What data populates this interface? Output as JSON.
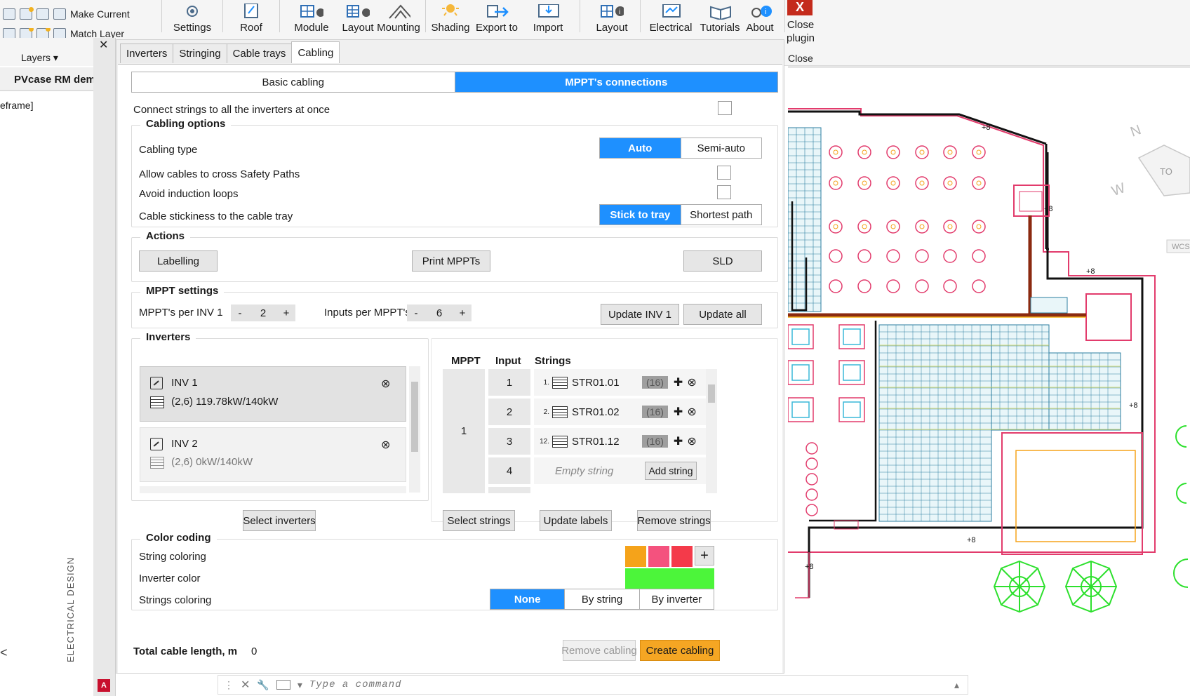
{
  "ribbon": {
    "layers_row1": "Make Current",
    "layers_row2": "Match Layer",
    "layers_panel": "Layers",
    "buttons": [
      {
        "label": "Settings",
        "icon": "gear-icon"
      },
      {
        "label": "Roof",
        "icon": "roof-icon"
      },
      {
        "label": "Module",
        "icon": "module-settings-icon"
      },
      {
        "label": "Layout",
        "icon": "layout-settings-icon"
      },
      {
        "label": "Mounting",
        "icon": "mounting-icon"
      },
      {
        "label": "Shading",
        "icon": "sun-icon"
      },
      {
        "label": "Export to",
        "icon": "export-icon"
      },
      {
        "label": "Import",
        "icon": "import-icon"
      },
      {
        "label": "Layout",
        "icon": "layout-info-icon"
      },
      {
        "label": "Electrical",
        "icon": "electrical-icon"
      },
      {
        "label": "Tutorials",
        "icon": "book-icon"
      },
      {
        "label": "About",
        "icon": "about-icon"
      }
    ],
    "close_plugin_line1": "Close",
    "close_plugin_line2": "plugin",
    "close_panel": "Close",
    "close_glyph": "X"
  },
  "document": {
    "tab_title": "PVcase RM dem",
    "viewport_label": "eframe]",
    "left_arrow": "<"
  },
  "sidebar": {
    "close_glyph": "✕",
    "vertical_title": "ELECTRICAL DESIGN"
  },
  "panel": {
    "tabs": [
      "Inverters",
      "Stringing",
      "Cable trays",
      "Cabling"
    ],
    "mode_tabs": [
      "Basic cabling",
      "MPPT's connections"
    ],
    "connect_all_label": "Connect strings to all the inverters at once",
    "cabling_options": {
      "title": "Cabling options",
      "cabling_type_label": "Cabling type",
      "cabling_type_options": [
        "Auto",
        "Semi-auto"
      ],
      "cross_safety_label": "Allow cables to cross Safety Paths",
      "avoid_loops_label": "Avoid induction loops",
      "stickiness_label": "Cable stickiness to the cable tray",
      "stickiness_options": [
        "Stick to tray",
        "Shortest path"
      ]
    },
    "actions": {
      "title": "Actions",
      "labelling": "Labelling",
      "print_mppts": "Print MPPTs",
      "sld": "SLD"
    },
    "mppt_settings": {
      "title": "MPPT settings",
      "mppt_per_inv_label": "MPPT's per INV 1",
      "mppt_per_inv_value": "2",
      "inputs_per_mppt_label": "Inputs per MPPT's",
      "inputs_per_mppt_value": "6",
      "minus": "-",
      "plus": "+",
      "update_inv": "Update INV 1",
      "update_all": "Update all"
    },
    "inverters": {
      "title": "Inverters",
      "items": [
        {
          "name": "INV 1",
          "detail": "(2,6)  119.78kW/140kW"
        },
        {
          "name": "INV 2",
          "detail": "(2,6)  0kW/140kW"
        }
      ],
      "remove_glyph": "⊗",
      "select_button": "Select inverters"
    },
    "mppt_table": {
      "headers": [
        "MPPT",
        "Input",
        "Strings"
      ],
      "mppt_value": "1",
      "inputs": [
        "1",
        "2",
        "3",
        "4"
      ],
      "strings": [
        {
          "idx": "1.",
          "name": "STR01.01",
          "badge": "(16)"
        },
        {
          "idx": "2.",
          "name": "STR01.02",
          "badge": "(16)"
        },
        {
          "idx": "12.",
          "name": "STR01.12",
          "badge": "(16)"
        }
      ],
      "empty_string": "Empty string",
      "add_string": "Add string",
      "plus_glyph": "✚",
      "remove_glyph": "⊗",
      "select_strings": "Select strings",
      "update_labels": "Update labels",
      "remove_strings": "Remove strings"
    },
    "color_coding": {
      "title": "Color coding",
      "string_coloring_label": "String coloring",
      "inverter_color_label": "Inverter color",
      "strings_coloring_label": "Strings coloring",
      "swatches": [
        "#f5a31a",
        "#f4527e",
        "#f43a4a"
      ],
      "add_glyph": "+",
      "inverter_color": "#4cf53a",
      "strings_coloring_options": [
        "None",
        "By string",
        "By inverter"
      ]
    },
    "footer": {
      "total_label": "Total cable length, m",
      "total_value": "0",
      "remove_cabling": "Remove cabling",
      "create_cabling": "Create cabling"
    }
  },
  "command_line": {
    "placeholder": "Type a command"
  },
  "canvas": {
    "labels": [
      "+8",
      "+8",
      "+8",
      "+8",
      "+8",
      "+8"
    ],
    "compass_n": "N",
    "compass_w": "W",
    "compass_top": "TO",
    "wcs": "WCS"
  },
  "colors": {
    "accent": "#1e90ff",
    "create_button": "#f5a623"
  }
}
